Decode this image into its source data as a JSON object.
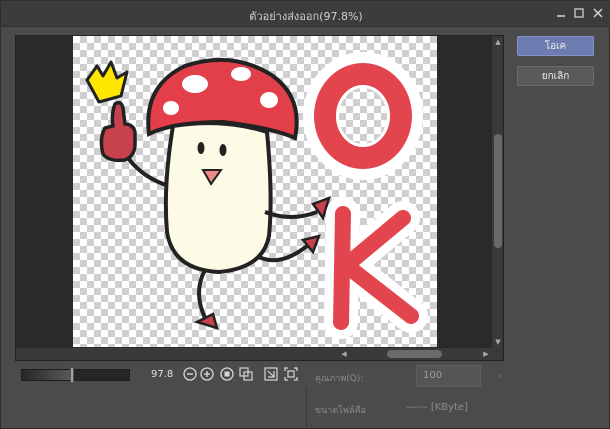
{
  "window": {
    "title": "ตัวอย่างส่งออก(97.8%)"
  },
  "buttons": {
    "ok": "โอเค",
    "cancel": "ยกเลิก"
  },
  "zoom": {
    "value": "97.8",
    "level_fraction": 0.47
  },
  "artwork": {
    "letters": [
      "O",
      "K"
    ]
  },
  "quality": {
    "label": "คุณภาพ(Q):",
    "value": "100"
  },
  "filesize": {
    "label": "ขนาดไฟล์คือ",
    "value": "------ [KByte]"
  },
  "icons": {
    "minimize": "minimize-icon",
    "maximize": "maximize-icon",
    "close": "close-icon",
    "zoom_out": "zoom-out-icon",
    "zoom_in": "zoom-in-icon",
    "actual_size": "actual-size-icon",
    "fit": "fit-window-icon"
  },
  "colors": {
    "primary_button": "#6c7bb0",
    "mushroom_red": "#e0424c",
    "letter_red": "#e2454e"
  }
}
